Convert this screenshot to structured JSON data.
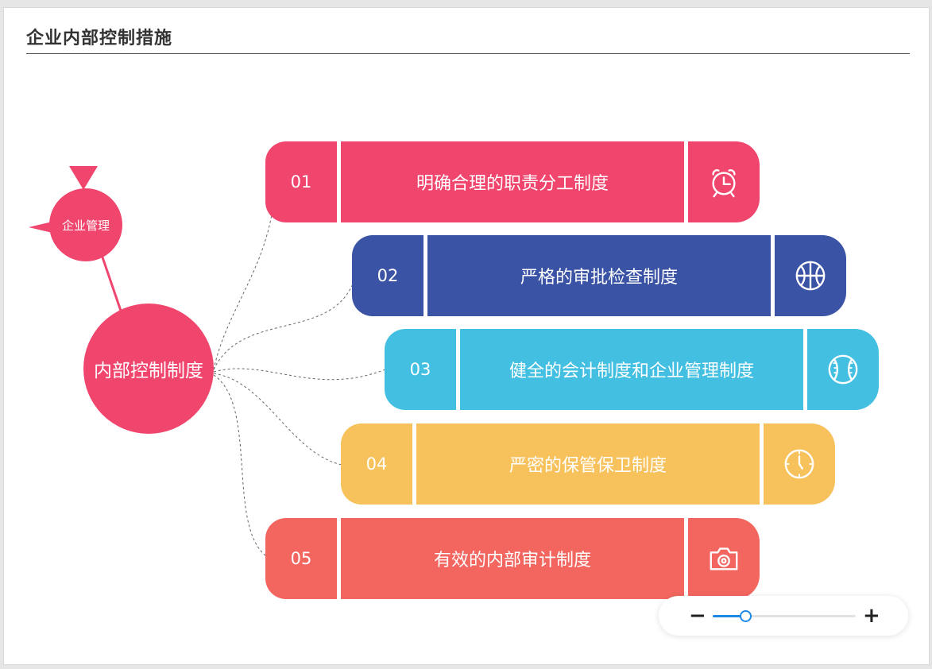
{
  "header": {
    "title": "企业内部控制措施"
  },
  "diagram": {
    "root": {
      "label": "内部控制制度",
      "color": "#f0466e"
    },
    "parent": {
      "label": "企业管理",
      "color": "#f0466e"
    },
    "items": [
      {
        "num": "01",
        "label": "明确合理的职责分工制度",
        "icon": "alarm-clock-icon",
        "color": "#f0466e"
      },
      {
        "num": "02",
        "label": "严格的审批检查制度",
        "icon": "basketball-icon",
        "color": "#3a53a4"
      },
      {
        "num": "03",
        "label": "健全的会计制度和企业管理制度",
        "icon": "baseball-icon",
        "color": "#43bfe2"
      },
      {
        "num": "04",
        "label": "严密的保管保卫制度",
        "icon": "clock-icon",
        "color": "#f7c25c"
      },
      {
        "num": "05",
        "label": "有效的内部审计制度",
        "icon": "camera-icon",
        "color": "#f3665f"
      }
    ]
  },
  "zoom": {
    "level": 0.23
  }
}
